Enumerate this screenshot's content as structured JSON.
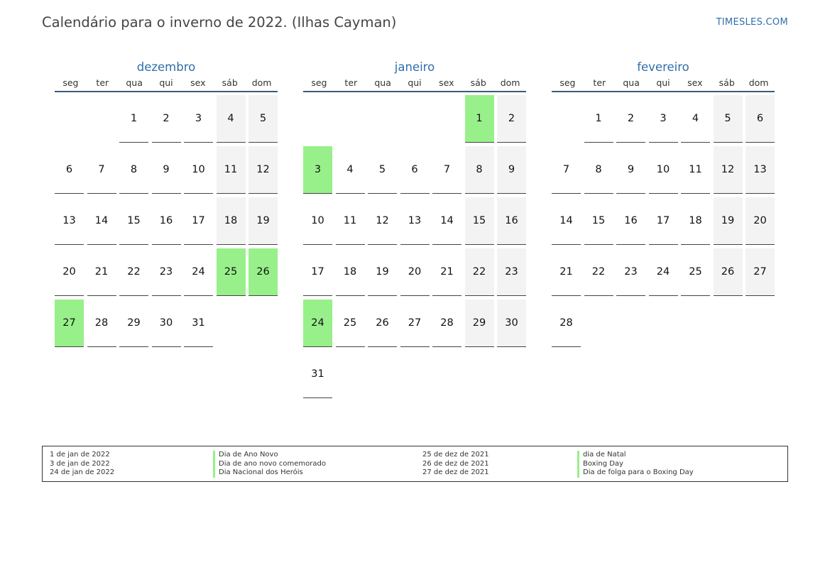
{
  "header": {
    "title": "Calendário para o inverno de 2022. (Ilhas Cayman)",
    "site": "TIMESLES.COM"
  },
  "weekdays": [
    "seg",
    "ter",
    "qua",
    "qui",
    "sex",
    "sáb",
    "dom"
  ],
  "colors": {
    "holiday": "#98f08a",
    "weekend": "#f3f3f3",
    "month_name": "#2f6eaa"
  },
  "months": [
    {
      "name": "dezembro",
      "offset": 2,
      "days": 31,
      "holidays": [
        25,
        26,
        27
      ]
    },
    {
      "name": "janeiro",
      "offset": 5,
      "days": 31,
      "holidays": [
        1,
        3,
        24
      ]
    },
    {
      "name": "fevereiro",
      "offset": 1,
      "days": 28,
      "holidays": []
    }
  ],
  "legend": {
    "left_dates": [
      "1 de jan de 2022",
      "3 de jan de 2022",
      "24 de jan de 2022"
    ],
    "left_names": [
      "Dia de Ano Novo",
      "Dia de ano novo comemorado",
      "Dia Nacional dos Heróis"
    ],
    "right_dates": [
      "25 de dez de 2021",
      "26 de dez de 2021",
      "27 de dez de 2021"
    ],
    "right_names": [
      "dia de Natal",
      "Boxing Day",
      "Dia de folga para o Boxing Day"
    ]
  }
}
